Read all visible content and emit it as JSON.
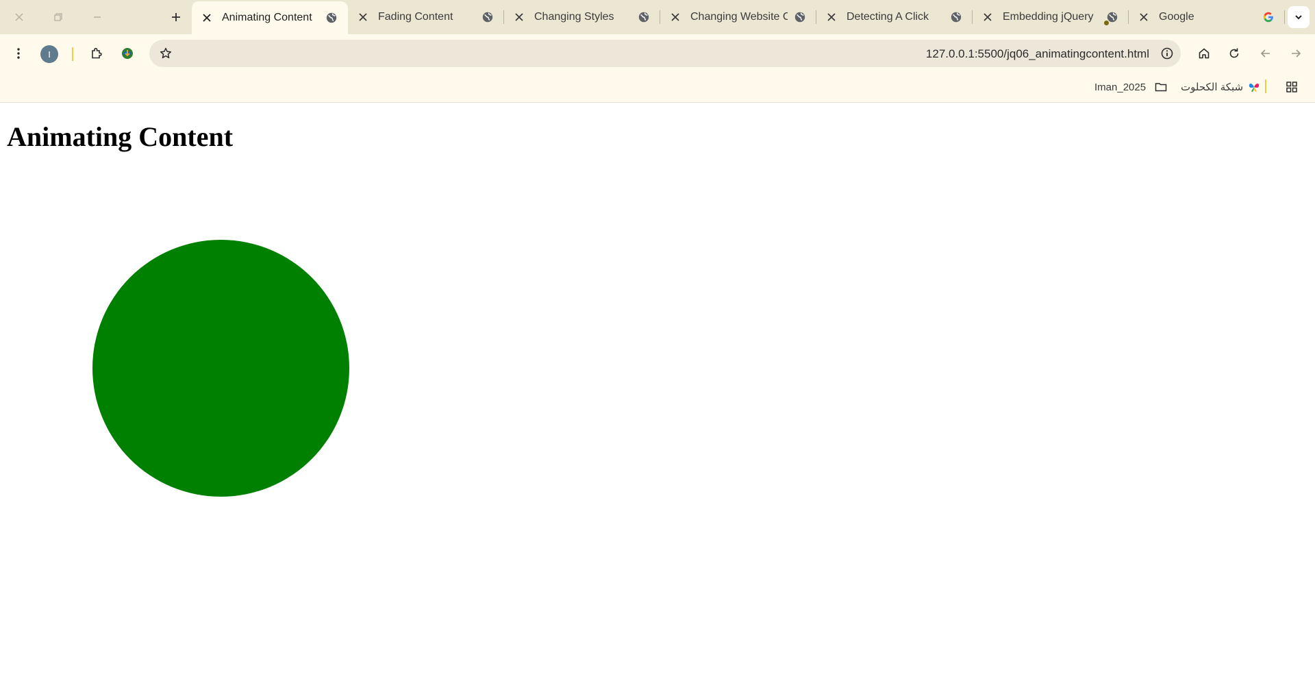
{
  "browser": {
    "tabs": [
      {
        "title": "Animating Content",
        "active": true
      },
      {
        "title": "Fading Content",
        "active": false
      },
      {
        "title": "Changing Styles",
        "active": false
      },
      {
        "title": "Changing Website Co",
        "active": false
      },
      {
        "title": "Detecting A Click",
        "active": false
      },
      {
        "title": "Embedding jQuery",
        "active": false
      },
      {
        "title": "Google",
        "active": false
      }
    ],
    "profile_initial": "I",
    "url": "127.0.0.1:5500/jq06_animatingcontent.html",
    "bookmarks": [
      {
        "label": "Iman_2025",
        "icon": "folder-icon"
      },
      {
        "label": "شبكة الكحلوت",
        "icon": "butterfly-icon"
      }
    ]
  },
  "page": {
    "heading": "Animating Content",
    "circle_color": "#008000"
  },
  "colors": {
    "tabstrip_bg": "#ece7d3",
    "toolbar_bg": "#fffaec",
    "omnibox_bg": "#ece7d9"
  }
}
